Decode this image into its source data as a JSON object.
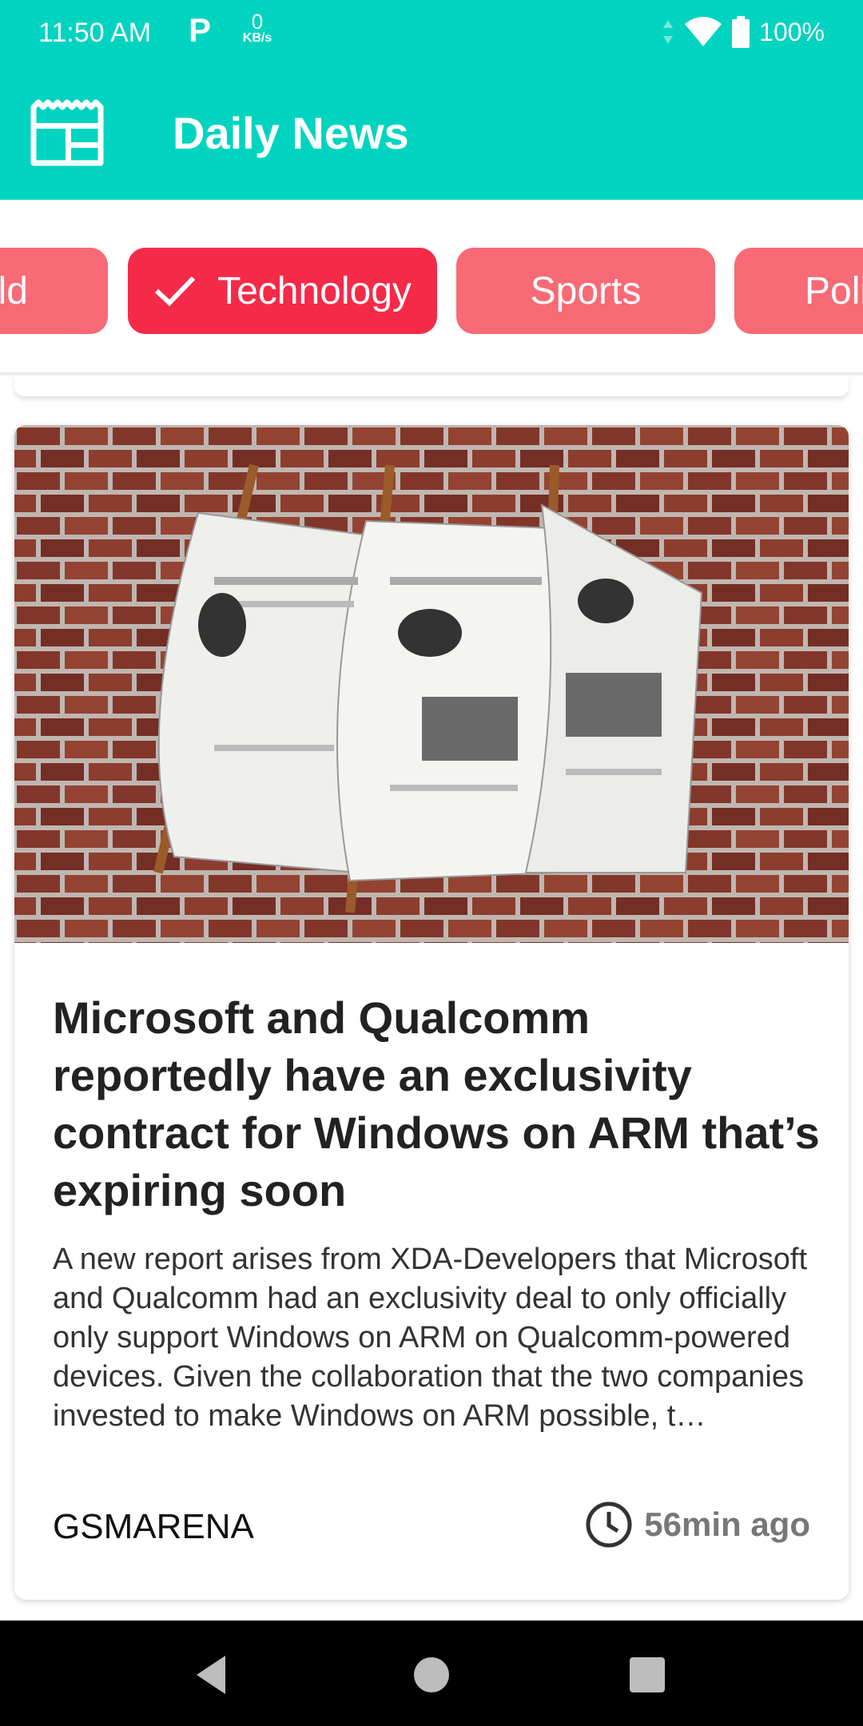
{
  "status_bar": {
    "time": "11:50 AM",
    "app_indicator": "P",
    "speed_value": "0",
    "speed_unit": "KB/s",
    "battery_percent": "100%"
  },
  "app_bar": {
    "icon": "newspaper-icon",
    "title": "Daily News"
  },
  "categories": [
    {
      "label": "World",
      "visible_text": "ld",
      "selected": false
    },
    {
      "label": "Technology",
      "selected": true
    },
    {
      "label": "Sports",
      "selected": false
    },
    {
      "label": "Politics",
      "visible_text": "Poli",
      "selected": false
    }
  ],
  "article": {
    "title": "Microsoft and Qualcomm reportedly have an exclusivity contract for Windows on ARM that’s expiring soon",
    "description": "A new report arises from XDA-Developers that Microsoft and Qualcomm had an exclusivity deal to only officially only support Windows on ARM on Qualcomm-powered devices. Given the collaboration that the two companies invested to make Windows on ARM possible, t…",
    "source": "GSMARENA",
    "time_ago": "56min ago",
    "clock_icon": "clock-icon"
  },
  "colors": {
    "primary": "#00d4c0",
    "chip": "#f86a75",
    "chip_selected": "#f52a49"
  }
}
